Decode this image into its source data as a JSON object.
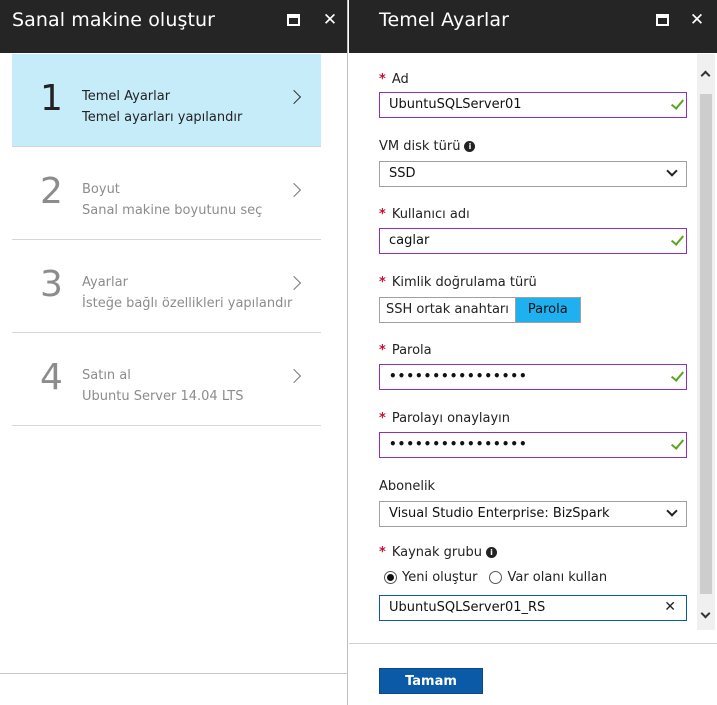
{
  "left_blade": {
    "title": "Sanal makine oluştur",
    "steps": [
      {
        "number": "1",
        "title": "Temel Ayarlar",
        "subtitle": "Temel ayarları yapılandır",
        "active": true
      },
      {
        "number": "2",
        "title": "Boyut",
        "subtitle": "Sanal makine boyutunu seç",
        "active": false
      },
      {
        "number": "3",
        "title": "Ayarlar",
        "subtitle": "İsteğe bağlı özellikleri yapılandır",
        "active": false
      },
      {
        "number": "4",
        "title": "Satın al",
        "subtitle": "Ubuntu Server 14.04 LTS",
        "active": false
      }
    ]
  },
  "right_blade": {
    "title": "Temel Ayarlar",
    "fields": {
      "name": {
        "label": "Ad",
        "required": true,
        "value": "UbuntuSQLServer01",
        "valid": true
      },
      "disk_type": {
        "label": "VM disk türü",
        "value": "SSD",
        "info_icon": "info-icon"
      },
      "username": {
        "label": "Kullanıcı adı",
        "required": true,
        "value": "caglar",
        "valid": true
      },
      "auth_type": {
        "label": "Kimlik doğrulama türü",
        "required": true,
        "options": [
          "SSH ortak anahtarı",
          "Parola"
        ],
        "selected": "Parola"
      },
      "password": {
        "label": "Parola",
        "required": true,
        "value": "••••••••••••••••",
        "valid": true
      },
      "password_confirm": {
        "label": "Parolayı onaylayın",
        "required": true,
        "value": "••••••••••••••••",
        "valid": true
      },
      "subscription": {
        "label": "Abonelik",
        "value": "Visual Studio Enterprise: BizSpark"
      },
      "resource_group": {
        "label": "Kaynak grubu",
        "required": true,
        "info_icon": "info-icon",
        "options": [
          "Yeni oluştur",
          "Var olanı kullan"
        ],
        "selected": "Yeni oluştur",
        "value": "UbuntuSQLServer01_RS"
      }
    },
    "ok_label": "Tamam"
  },
  "colors": {
    "header_bg": "#252525",
    "active_step_bg": "#c6ecf9",
    "required_star": "#c8102e",
    "input_border_active": "#8b2fc9",
    "valid_check": "#5aa51e",
    "segment_selected": "#1fb0f0",
    "ok_button": "#0a5aa8"
  },
  "icons": {
    "maximize": "maximize-icon",
    "close": "close-icon",
    "chevron_right": "chevron-right-icon",
    "chevron_down": "chevron-down-icon",
    "checkmark": "checkmark-icon",
    "clear": "clear-icon"
  }
}
